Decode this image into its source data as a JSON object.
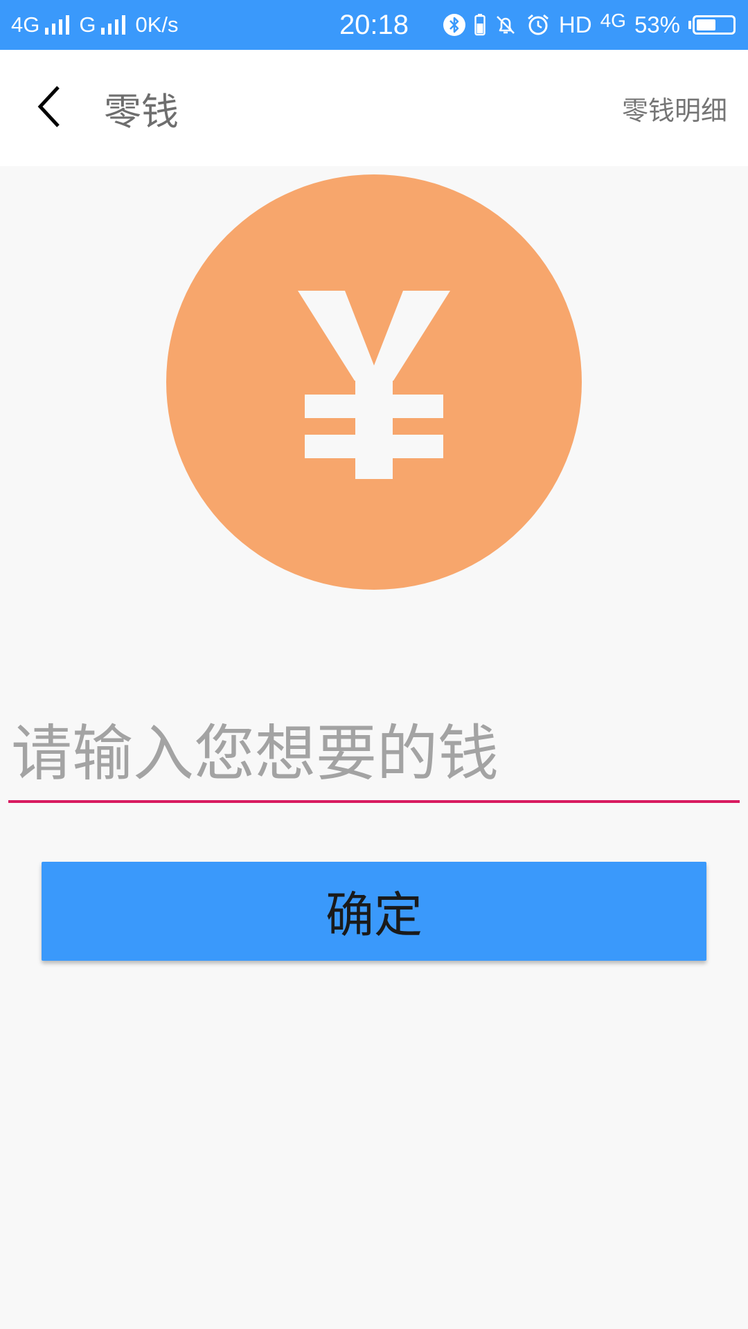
{
  "status_bar": {
    "network_1": "4G",
    "network_2": "G",
    "speed": "0K/s",
    "time": "20:18",
    "hd": "HD",
    "network_3": "4G",
    "battery_text": "53%",
    "battery_level": 0.53,
    "icons": [
      "bluetooth-icon",
      "battery-small-icon",
      "mute-icon",
      "alarm-icon"
    ]
  },
  "header": {
    "title": "零钱",
    "detail_link": "零钱明细",
    "back_icon": "chevron-left-icon"
  },
  "main": {
    "coin_icon": "yen-icon",
    "coin_symbol": "¥",
    "input_placeholder": "请输入您想要的钱",
    "confirm_label": "确定"
  },
  "colors": {
    "status_bar": "#3a99fb",
    "coin": "#f7a66c",
    "input_underline": "#d81b60",
    "button": "#3a99fb"
  }
}
